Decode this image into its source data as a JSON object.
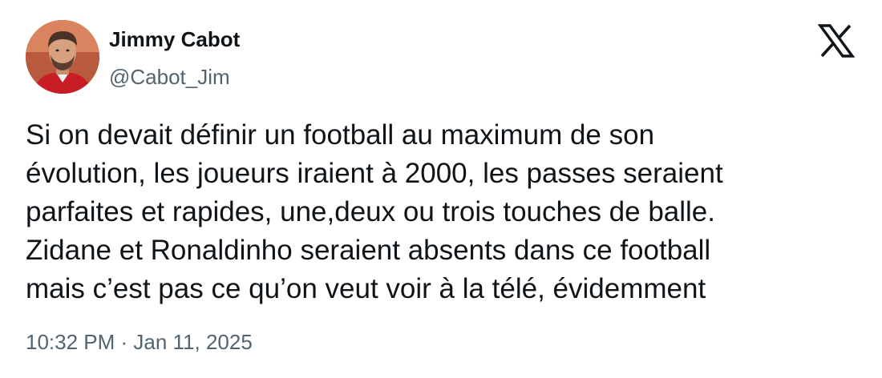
{
  "author": {
    "name": "Jimmy Cabot",
    "handle": "@Cabot_Jim"
  },
  "brand_icon": "x-logo-icon",
  "tweet": {
    "lines": [
      "Si on devait définir un football au maximum de son",
      "évolution, les joueurs iraient à 2000, les passes seraient",
      "parfaites et rapides, une,deux ou trois touches de balle.",
      "Zidane et Ronaldinho seraient absents dans ce football",
      "mais c’est pas ce qu’on veut voir à la télé, évidemment"
    ]
  },
  "meta": {
    "timestamp": "10:32 PM · Jan 11, 2025"
  },
  "colors": {
    "text_primary": "#0f1419",
    "text_secondary": "#536471",
    "background": "#ffffff"
  }
}
